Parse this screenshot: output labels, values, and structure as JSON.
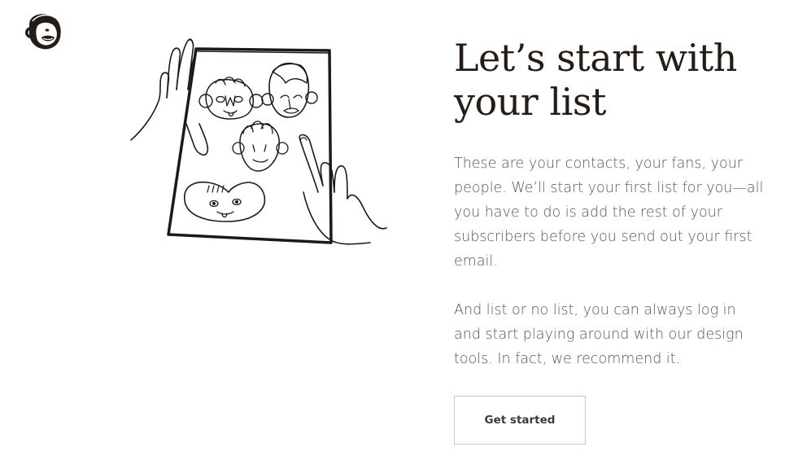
{
  "brand": {
    "logo_icon": "mailchimp-freddie-icon"
  },
  "illustration": {
    "icon": "hands-holding-contact-list-drawing"
  },
  "main": {
    "headline": "Let’s start with your list",
    "paragraph_1": "These are your contacts, your fans, your people. We’ll start your first list for you—all you have to do is add the rest of your subscribers before you send out your first email.",
    "paragraph_2": "And list or no list, you can always log in and start playing around with our design tools. In fact, we recommend it.",
    "cta_label": "Get started"
  },
  "colors": {
    "text_dark": "#241c15",
    "text_body": "#5a5551",
    "button_border": "#c9c6c2"
  }
}
